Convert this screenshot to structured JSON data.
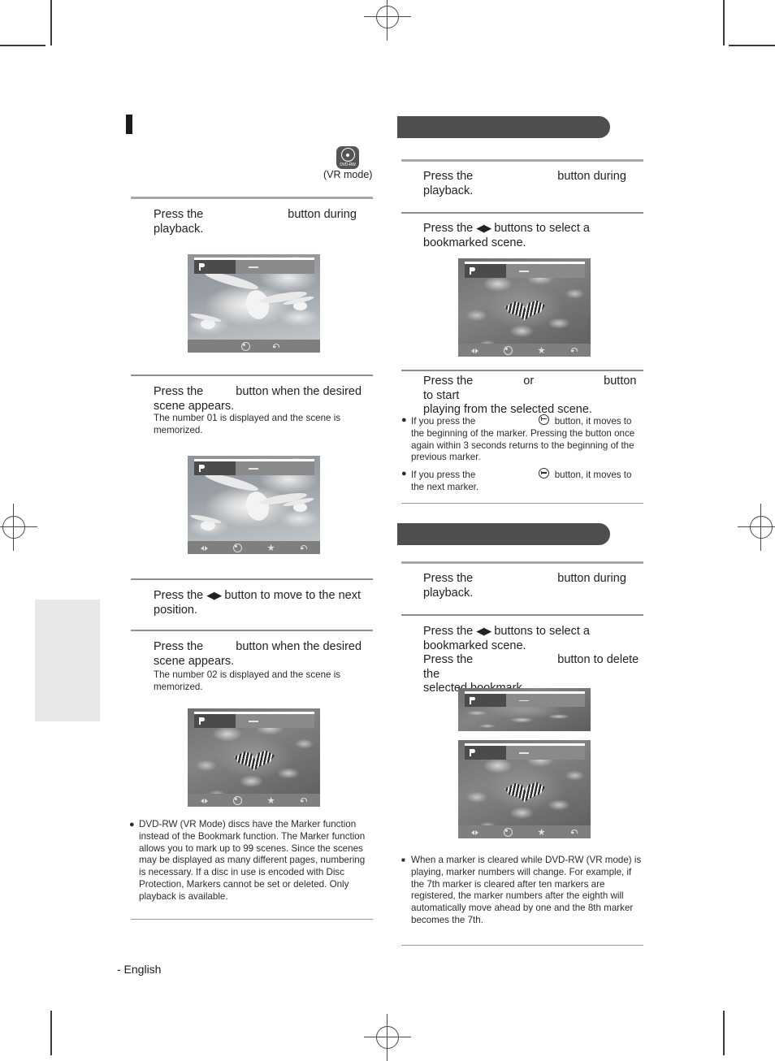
{
  "page": {
    "footer_text": "- English",
    "language": "English"
  },
  "disc_badge": {
    "icon": "dvd-rw-disc-icon",
    "label": "DVD-RW",
    "caption": "(VR mode)"
  },
  "left_column": {
    "section_marker": "section-title-marker",
    "steps": [
      {
        "id": "step-1",
        "text_before": "Press the",
        "text_after": "button during",
        "line2": "playback.",
        "note": ""
      },
      {
        "id": "step-2",
        "text_before": "Press the",
        "text_after": "button when the desired",
        "line2": "scene appears.",
        "note": "The number 01 is displayed and the scene is memorized."
      },
      {
        "id": "step-3",
        "text_before": "Press the",
        "arrows": "◀▶",
        "text_after": "button to move to the next",
        "line2": "position.",
        "note": ""
      },
      {
        "id": "step-4",
        "text_before": "Press the",
        "text_after": "button when the desired",
        "line2": "scene appears.",
        "note": "The number 02 is displayed and the scene is memorized."
      }
    ],
    "bullets": [
      {
        "mark": "●",
        "text": "DVD-RW (VR Mode) discs have the Marker function instead of the Bookmark function. The Marker function allows you to mark up to 99 scenes. Since the scenes may be displayed as many different pages, numbering is necessary. If a disc in use is encoded with Disc Protection, Markers cannot be set or deleted. Only playback is available."
      }
    ],
    "screens": [
      {
        "id": "screen-seagulls-1",
        "scene": "sky",
        "bottom_icons": [
          "select-icon",
          "return-icon"
        ]
      },
      {
        "id": "screen-seagulls-2",
        "scene": "sky",
        "bottom_icons": [
          "left-right-icon",
          "select-icon",
          "mark-icon",
          "return-icon"
        ]
      },
      {
        "id": "screen-butterfly-1",
        "scene": "flowers",
        "bottom_icons": [
          "left-right-icon",
          "select-icon",
          "mark-icon",
          "return-icon"
        ]
      }
    ]
  },
  "right_column": {
    "headings": [
      {
        "id": "heading-playing-bookmark",
        "label": ""
      },
      {
        "id": "heading-deleting-bookmark",
        "label": ""
      }
    ],
    "section_a": {
      "steps": [
        {
          "id": "step-a1",
          "text_before": "Press the",
          "text_after": "button during",
          "line2": "playback."
        },
        {
          "id": "step-a2",
          "text_before": "Press the",
          "arrows": "◀▶",
          "text_after": "buttons to select a",
          "line2": "bookmarked scene."
        },
        {
          "id": "step-a3",
          "text_before": "Press the",
          "mid": "or",
          "text_after": "button to start",
          "line2": "playing from the selected scene."
        }
      ],
      "bullets": [
        {
          "mark": "●",
          "icon": "skip-back-icon",
          "pre": "If you press the",
          "post": "button, it moves to the beginning of the marker. Pressing the button once again within 3 seconds returns to the beginning of the previous marker."
        },
        {
          "mark": "●",
          "icon": "skip-forward-icon",
          "pre": "If you press the",
          "post": "button, it moves to the next marker."
        }
      ],
      "screens": [
        {
          "id": "screen-butterfly-play",
          "scene": "flowers",
          "bottom_icons": [
            "left-right-icon",
            "select-icon",
            "mark-icon",
            "return-icon"
          ]
        }
      ]
    },
    "section_b": {
      "steps": [
        {
          "id": "step-b1",
          "text_before": "Press the",
          "text_after": "button during",
          "line2": "playback."
        },
        {
          "id": "step-b2",
          "text_before": "Press the",
          "arrows": "◀▶",
          "text_after": "buttons to select a",
          "line2": "bookmarked scene.",
          "line3_before": "Press the",
          "line3_after": "button to delete the",
          "line4": "selected bookmark."
        }
      ],
      "bullets": [
        {
          "mark": "■",
          "text": "When a marker is cleared while DVD-RW (VR mode) is playing, marker numbers will change. For example, if the 7th marker is cleared after ten markers are registered, the marker numbers after the eighth will automatically move ahead by one and the 8th marker becomes the 7th."
        }
      ],
      "screens": [
        {
          "id": "screen-butterfly-crop",
          "scene": "flowers",
          "cropped": true
        },
        {
          "id": "screen-butterfly-delete",
          "scene": "flowers",
          "bottom_icons": [
            "left-right-icon",
            "select-icon",
            "mark-icon",
            "return-icon"
          ]
        }
      ]
    }
  },
  "marks": {
    "registration": "registration-crosshair"
  }
}
